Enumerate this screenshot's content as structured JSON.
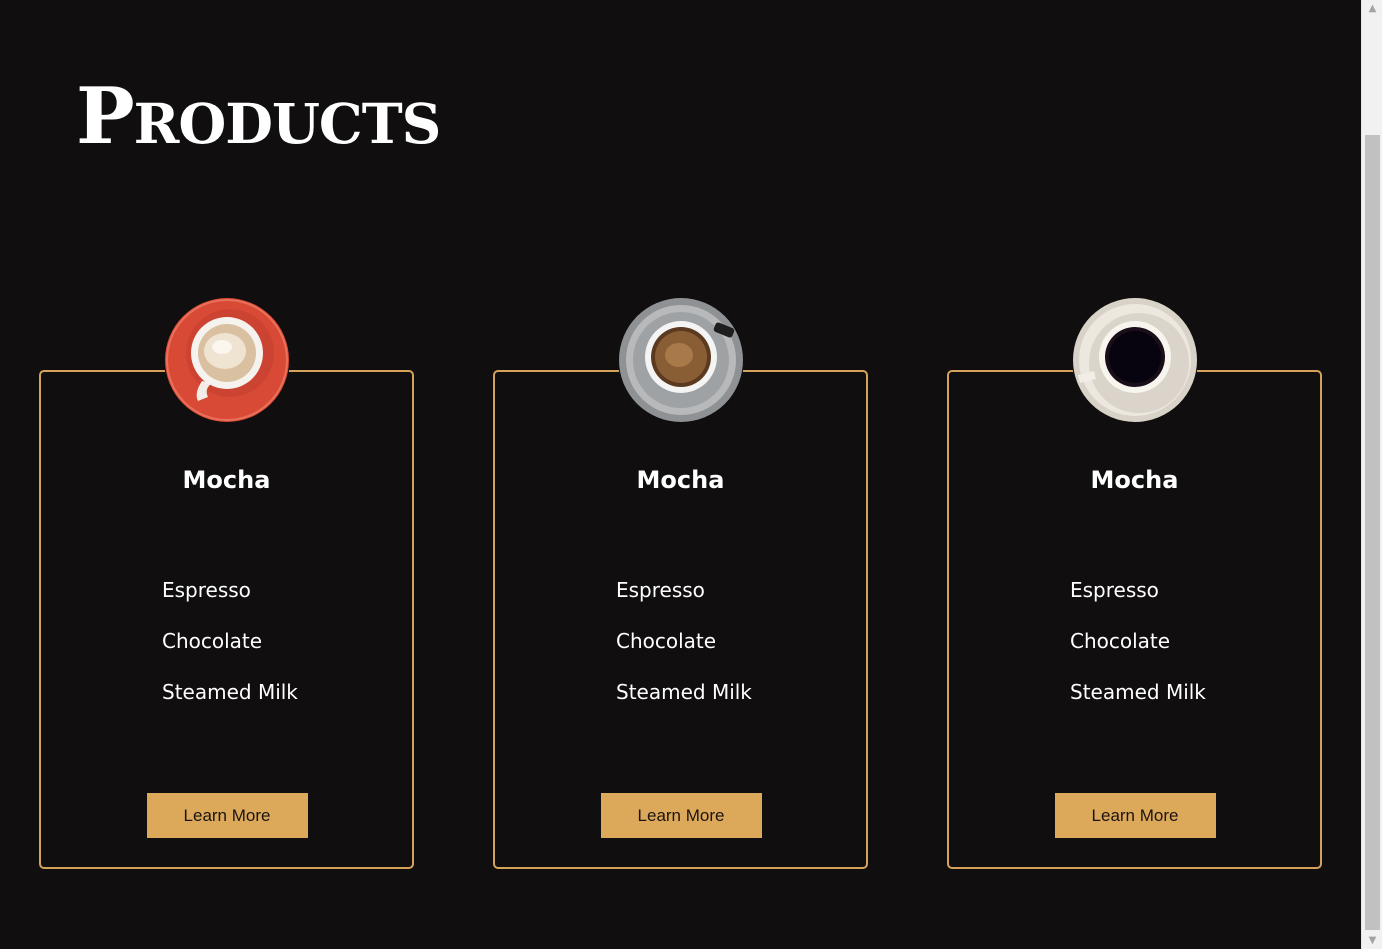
{
  "page": {
    "title": "Products"
  },
  "products": [
    {
      "name": "Mocha",
      "image_icon": "coffee-cup-red-saucer-icon",
      "ingredients": [
        "Espresso",
        "Chocolate",
        "Steamed Milk"
      ],
      "button_label": "Learn More"
    },
    {
      "name": "Mocha",
      "image_icon": "coffee-cup-grey-saucer-icon",
      "ingredients": [
        "Espresso",
        "Chocolate",
        "Steamed Milk"
      ],
      "button_label": "Learn More"
    },
    {
      "name": "Mocha",
      "image_icon": "coffee-cup-white-saucer-icon",
      "ingredients": [
        "Espresso",
        "Chocolate",
        "Steamed Milk"
      ],
      "button_label": "Learn More"
    }
  ],
  "colors": {
    "background": "#100e0f",
    "accent": "#dca95b",
    "card_border": "#d4a25a",
    "text": "#ffffff"
  }
}
